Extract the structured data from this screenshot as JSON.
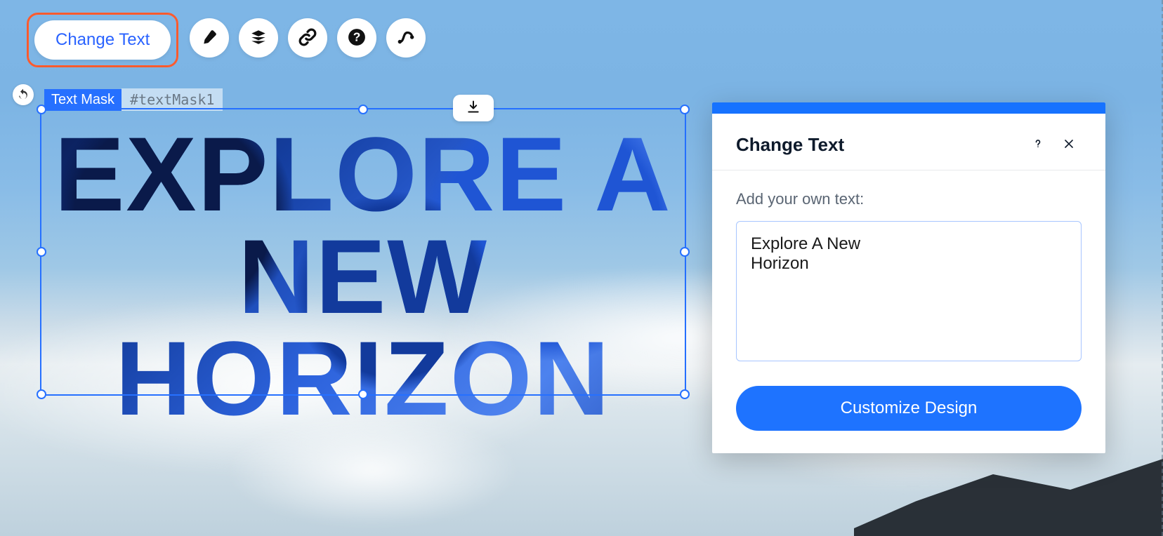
{
  "toolbar": {
    "change_text_label": "Change Text"
  },
  "element_label": {
    "name": "Text Mask",
    "id": "#textMask1"
  },
  "mask_text": "Explore A New Horizon",
  "panel": {
    "title": "Change Text",
    "input_label": "Add your own text:",
    "input_value": "Explore A New\nHorizon",
    "primary_button": "Customize Design"
  }
}
